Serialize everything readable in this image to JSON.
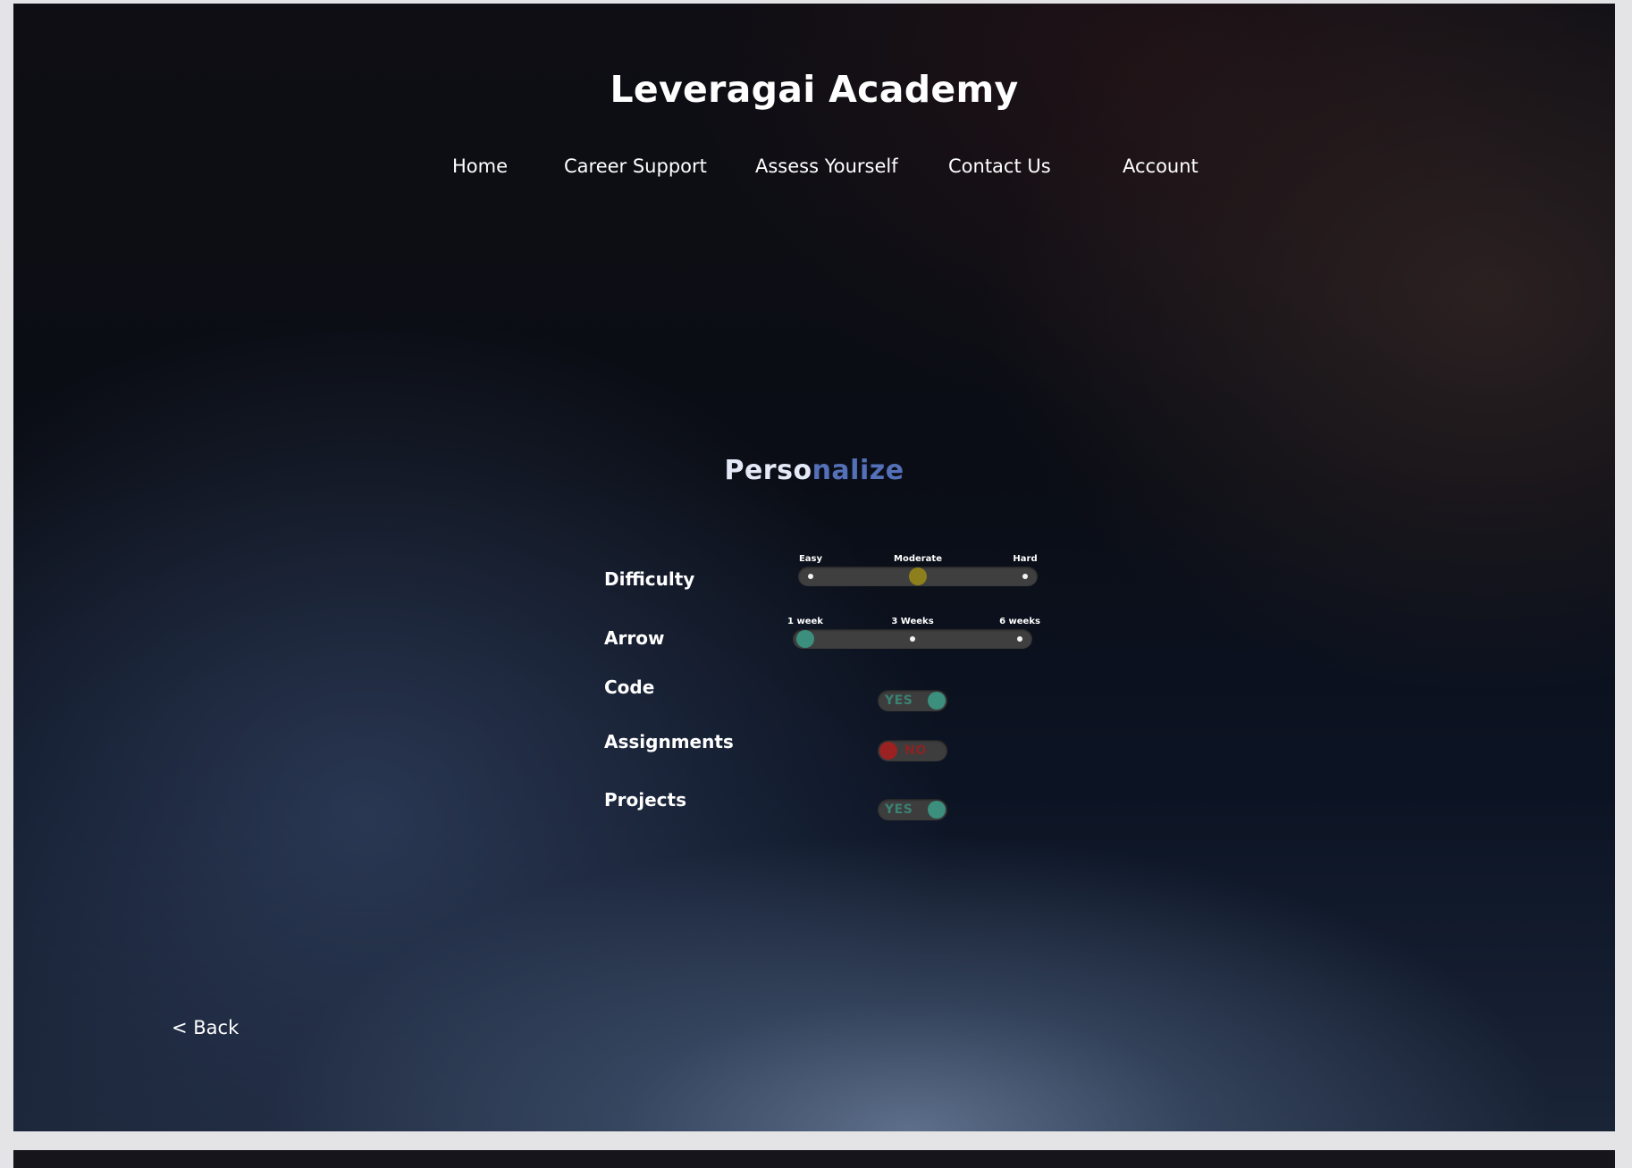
{
  "site_title": "Leveragai Academy",
  "nav": {
    "home": "Home",
    "career_support": "Career Support",
    "assess_yourself": "Assess Yourself",
    "contact_us": "Contact Us",
    "account": "Account"
  },
  "personalize": {
    "title_part1": "Perso",
    "title_part2": "nalize",
    "title_colors": {
      "part1": "#e3e9f6",
      "part2": "#5470b8"
    },
    "difficulty": {
      "label": "Difficulty",
      "options": [
        "Easy",
        "Moderate",
        "Hard"
      ],
      "selected": "Moderate",
      "knob_color": "#8d7f1c"
    },
    "duration": {
      "label": "Arrow",
      "options": [
        "1 week",
        "3 Weeks",
        "6 weeks"
      ],
      "selected": "1 week",
      "knob_color": "#3b8f7c"
    },
    "code": {
      "label": "Code",
      "value": "YES",
      "on": true
    },
    "assignments": {
      "label": "Assignments",
      "value": "NO",
      "on": false
    },
    "projects": {
      "label": "Projects",
      "value": "YES",
      "on": true
    }
  },
  "colors": {
    "toggle_on": "#3b8f7c",
    "toggle_off": "#9b2222",
    "toggle_on_text": "#3a8272",
    "toggle_off_text": "#8a2323"
  },
  "back_link": "< Back"
}
